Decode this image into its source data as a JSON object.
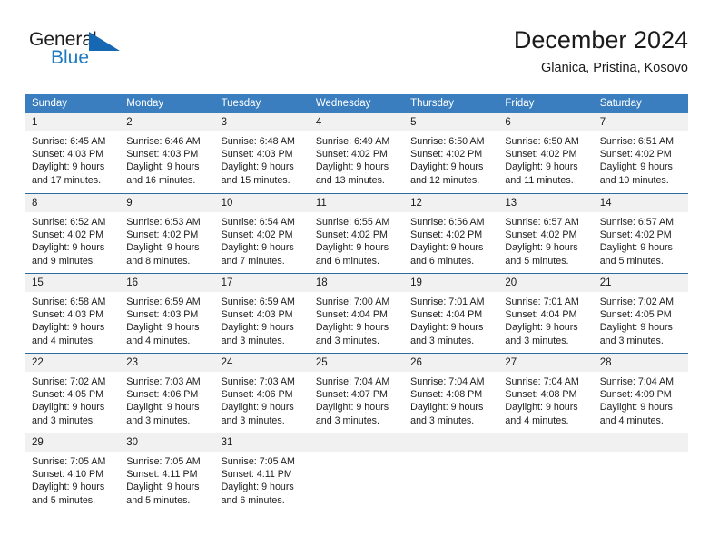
{
  "brand": {
    "name_part1": "General",
    "name_part2": "Blue",
    "logo_icon": "triangle-logo-icon",
    "accent_color": "#1668b3"
  },
  "header": {
    "title": "December 2024",
    "subtitle": "Glanica, Pristina, Kosovo"
  },
  "calendar": {
    "header_bg": "#3a7ebf",
    "daynum_bg": "#f1f1f1",
    "weekday_headers": [
      "Sunday",
      "Monday",
      "Tuesday",
      "Wednesday",
      "Thursday",
      "Friday",
      "Saturday"
    ],
    "weeks": [
      [
        {
          "day": "1",
          "sunrise": "Sunrise: 6:45 AM",
          "sunset": "Sunset: 4:03 PM",
          "daylight_line1": "Daylight: 9 hours",
          "daylight_line2": "and 17 minutes."
        },
        {
          "day": "2",
          "sunrise": "Sunrise: 6:46 AM",
          "sunset": "Sunset: 4:03 PM",
          "daylight_line1": "Daylight: 9 hours",
          "daylight_line2": "and 16 minutes."
        },
        {
          "day": "3",
          "sunrise": "Sunrise: 6:48 AM",
          "sunset": "Sunset: 4:03 PM",
          "daylight_line1": "Daylight: 9 hours",
          "daylight_line2": "and 15 minutes."
        },
        {
          "day": "4",
          "sunrise": "Sunrise: 6:49 AM",
          "sunset": "Sunset: 4:02 PM",
          "daylight_line1": "Daylight: 9 hours",
          "daylight_line2": "and 13 minutes."
        },
        {
          "day": "5",
          "sunrise": "Sunrise: 6:50 AM",
          "sunset": "Sunset: 4:02 PM",
          "daylight_line1": "Daylight: 9 hours",
          "daylight_line2": "and 12 minutes."
        },
        {
          "day": "6",
          "sunrise": "Sunrise: 6:50 AM",
          "sunset": "Sunset: 4:02 PM",
          "daylight_line1": "Daylight: 9 hours",
          "daylight_line2": "and 11 minutes."
        },
        {
          "day": "7",
          "sunrise": "Sunrise: 6:51 AM",
          "sunset": "Sunset: 4:02 PM",
          "daylight_line1": "Daylight: 9 hours",
          "daylight_line2": "and 10 minutes."
        }
      ],
      [
        {
          "day": "8",
          "sunrise": "Sunrise: 6:52 AM",
          "sunset": "Sunset: 4:02 PM",
          "daylight_line1": "Daylight: 9 hours",
          "daylight_line2": "and 9 minutes."
        },
        {
          "day": "9",
          "sunrise": "Sunrise: 6:53 AM",
          "sunset": "Sunset: 4:02 PM",
          "daylight_line1": "Daylight: 9 hours",
          "daylight_line2": "and 8 minutes."
        },
        {
          "day": "10",
          "sunrise": "Sunrise: 6:54 AM",
          "sunset": "Sunset: 4:02 PM",
          "daylight_line1": "Daylight: 9 hours",
          "daylight_line2": "and 7 minutes."
        },
        {
          "day": "11",
          "sunrise": "Sunrise: 6:55 AM",
          "sunset": "Sunset: 4:02 PM",
          "daylight_line1": "Daylight: 9 hours",
          "daylight_line2": "and 6 minutes."
        },
        {
          "day": "12",
          "sunrise": "Sunrise: 6:56 AM",
          "sunset": "Sunset: 4:02 PM",
          "daylight_line1": "Daylight: 9 hours",
          "daylight_line2": "and 6 minutes."
        },
        {
          "day": "13",
          "sunrise": "Sunrise: 6:57 AM",
          "sunset": "Sunset: 4:02 PM",
          "daylight_line1": "Daylight: 9 hours",
          "daylight_line2": "and 5 minutes."
        },
        {
          "day": "14",
          "sunrise": "Sunrise: 6:57 AM",
          "sunset": "Sunset: 4:02 PM",
          "daylight_line1": "Daylight: 9 hours",
          "daylight_line2": "and 5 minutes."
        }
      ],
      [
        {
          "day": "15",
          "sunrise": "Sunrise: 6:58 AM",
          "sunset": "Sunset: 4:03 PM",
          "daylight_line1": "Daylight: 9 hours",
          "daylight_line2": "and 4 minutes."
        },
        {
          "day": "16",
          "sunrise": "Sunrise: 6:59 AM",
          "sunset": "Sunset: 4:03 PM",
          "daylight_line1": "Daylight: 9 hours",
          "daylight_line2": "and 4 minutes."
        },
        {
          "day": "17",
          "sunrise": "Sunrise: 6:59 AM",
          "sunset": "Sunset: 4:03 PM",
          "daylight_line1": "Daylight: 9 hours",
          "daylight_line2": "and 3 minutes."
        },
        {
          "day": "18",
          "sunrise": "Sunrise: 7:00 AM",
          "sunset": "Sunset: 4:04 PM",
          "daylight_line1": "Daylight: 9 hours",
          "daylight_line2": "and 3 minutes."
        },
        {
          "day": "19",
          "sunrise": "Sunrise: 7:01 AM",
          "sunset": "Sunset: 4:04 PM",
          "daylight_line1": "Daylight: 9 hours",
          "daylight_line2": "and 3 minutes."
        },
        {
          "day": "20",
          "sunrise": "Sunrise: 7:01 AM",
          "sunset": "Sunset: 4:04 PM",
          "daylight_line1": "Daylight: 9 hours",
          "daylight_line2": "and 3 minutes."
        },
        {
          "day": "21",
          "sunrise": "Sunrise: 7:02 AM",
          "sunset": "Sunset: 4:05 PM",
          "daylight_line1": "Daylight: 9 hours",
          "daylight_line2": "and 3 minutes."
        }
      ],
      [
        {
          "day": "22",
          "sunrise": "Sunrise: 7:02 AM",
          "sunset": "Sunset: 4:05 PM",
          "daylight_line1": "Daylight: 9 hours",
          "daylight_line2": "and 3 minutes."
        },
        {
          "day": "23",
          "sunrise": "Sunrise: 7:03 AM",
          "sunset": "Sunset: 4:06 PM",
          "daylight_line1": "Daylight: 9 hours",
          "daylight_line2": "and 3 minutes."
        },
        {
          "day": "24",
          "sunrise": "Sunrise: 7:03 AM",
          "sunset": "Sunset: 4:06 PM",
          "daylight_line1": "Daylight: 9 hours",
          "daylight_line2": "and 3 minutes."
        },
        {
          "day": "25",
          "sunrise": "Sunrise: 7:04 AM",
          "sunset": "Sunset: 4:07 PM",
          "daylight_line1": "Daylight: 9 hours",
          "daylight_line2": "and 3 minutes."
        },
        {
          "day": "26",
          "sunrise": "Sunrise: 7:04 AM",
          "sunset": "Sunset: 4:08 PM",
          "daylight_line1": "Daylight: 9 hours",
          "daylight_line2": "and 3 minutes."
        },
        {
          "day": "27",
          "sunrise": "Sunrise: 7:04 AM",
          "sunset": "Sunset: 4:08 PM",
          "daylight_line1": "Daylight: 9 hours",
          "daylight_line2": "and 4 minutes."
        },
        {
          "day": "28",
          "sunrise": "Sunrise: 7:04 AM",
          "sunset": "Sunset: 4:09 PM",
          "daylight_line1": "Daylight: 9 hours",
          "daylight_line2": "and 4 minutes."
        }
      ],
      [
        {
          "day": "29",
          "sunrise": "Sunrise: 7:05 AM",
          "sunset": "Sunset: 4:10 PM",
          "daylight_line1": "Daylight: 9 hours",
          "daylight_line2": "and 5 minutes."
        },
        {
          "day": "30",
          "sunrise": "Sunrise: 7:05 AM",
          "sunset": "Sunset: 4:11 PM",
          "daylight_line1": "Daylight: 9 hours",
          "daylight_line2": "and 5 minutes."
        },
        {
          "day": "31",
          "sunrise": "Sunrise: 7:05 AM",
          "sunset": "Sunset: 4:11 PM",
          "daylight_line1": "Daylight: 9 hours",
          "daylight_line2": "and 6 minutes."
        },
        {
          "day": "",
          "sunrise": "",
          "sunset": "",
          "daylight_line1": "",
          "daylight_line2": ""
        },
        {
          "day": "",
          "sunrise": "",
          "sunset": "",
          "daylight_line1": "",
          "daylight_line2": ""
        },
        {
          "day": "",
          "sunrise": "",
          "sunset": "",
          "daylight_line1": "",
          "daylight_line2": ""
        },
        {
          "day": "",
          "sunrise": "",
          "sunset": "",
          "daylight_line1": "",
          "daylight_line2": ""
        }
      ]
    ]
  }
}
